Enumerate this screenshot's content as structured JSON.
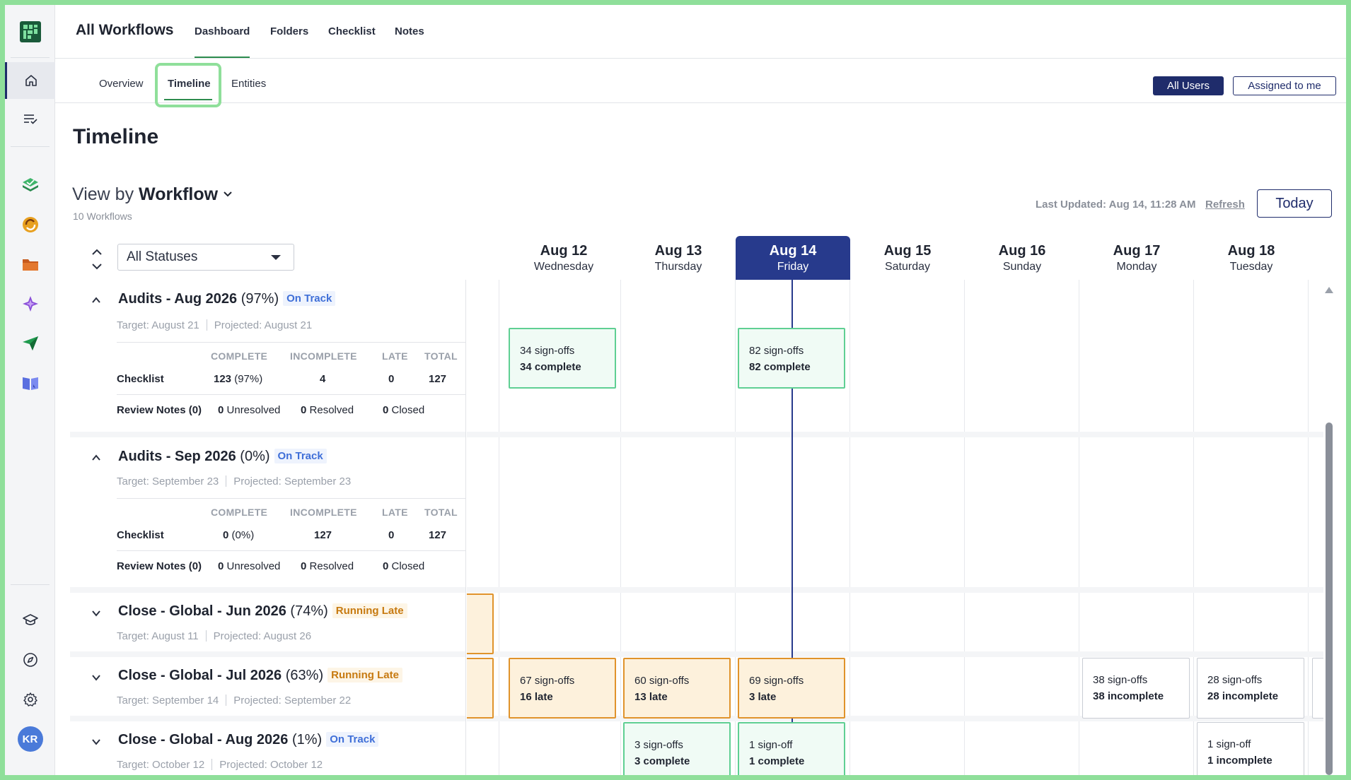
{
  "app": {
    "title": "All Workflows"
  },
  "topnav": [
    "Dashboard",
    "Folders",
    "Checklist",
    "Notes"
  ],
  "subnav": [
    "Overview",
    "Timeline",
    "Entities"
  ],
  "user_filter": {
    "all_users": "All Users",
    "assigned_to_me": "Assigned to me"
  },
  "page": {
    "title": "Timeline",
    "viewby_prefix": "View by",
    "viewby_value": "Workflow",
    "workflow_count": "10 Workflows",
    "last_updated": "Last Updated: Aug 14, 11:28 AM",
    "refresh": "Refresh",
    "today": "Today"
  },
  "status_filter": {
    "value": "All Statuses"
  },
  "days": [
    {
      "date": "Aug 12",
      "weekday": "Wednesday"
    },
    {
      "date": "Aug 13",
      "weekday": "Thursday"
    },
    {
      "date": "Aug 14",
      "weekday": "Friday",
      "today": true
    },
    {
      "date": "Aug 15",
      "weekday": "Saturday"
    },
    {
      "date": "Aug 16",
      "weekday": "Sunday"
    },
    {
      "date": "Aug 17",
      "weekday": "Monday"
    },
    {
      "date": "Aug 18",
      "weekday": "Tuesday"
    }
  ],
  "stat_headers": [
    "COMPLETE",
    "INCOMPLETE",
    "LATE",
    "TOTAL"
  ],
  "workflows": [
    {
      "name": "Audits - Aug 2026",
      "pct": "(97%)",
      "status": "On Track",
      "target": "Target: August 21",
      "projected": "Projected: August 21",
      "checklist": {
        "label": "Checklist",
        "complete": "123",
        "complete_pct": "(97%)",
        "incomplete": "4",
        "late": "0",
        "total": "127"
      },
      "notes": {
        "label": "Review Notes (0)",
        "unresolved": "0",
        "unresolved_label": "Unresolved",
        "resolved": "0",
        "resolved_label": "Resolved",
        "closed": "0",
        "closed_label": "Closed"
      }
    },
    {
      "name": "Audits - Sep 2026",
      "pct": "(0%)",
      "status": "On Track",
      "target": "Target: September 23",
      "projected": "Projected: September 23",
      "checklist": {
        "label": "Checklist",
        "complete": "0",
        "complete_pct": "(0%)",
        "incomplete": "127",
        "late": "0",
        "total": "127"
      },
      "notes": {
        "label": "Review Notes (0)",
        "unresolved": "0",
        "unresolved_label": "Unresolved",
        "resolved": "0",
        "resolved_label": "Resolved",
        "closed": "0",
        "closed_label": "Closed"
      }
    },
    {
      "name": "Close - Global - Jun 2026",
      "pct": "(74%)",
      "status": "Running Late",
      "target": "Target: August 11",
      "projected": "Projected: August 26"
    },
    {
      "name": "Close - Global - Jul 2026",
      "pct": "(63%)",
      "status": "Running Late",
      "target": "Target: September 14",
      "projected": "Projected: September 22"
    },
    {
      "name": "Close - Global - Aug 2026",
      "pct": "(1%)",
      "status": "On Track",
      "target": "Target: October 12",
      "projected": "Projected: October 12"
    }
  ],
  "events": [
    {
      "l1": "34 sign-offs",
      "l2": "34 complete"
    },
    {
      "l1": "82 sign-offs",
      "l2": "82 complete"
    },
    {
      "l1": "67 sign-offs",
      "l2": "16 late"
    },
    {
      "l1": "60 sign-offs",
      "l2": "13 late"
    },
    {
      "l1": "69 sign-offs",
      "l2": "3 late"
    },
    {
      "l1": "38 sign-offs",
      "l2": "38 incomplete"
    },
    {
      "l1": "28 sign-offs",
      "l2": "28 incomplete"
    },
    {
      "l1": "3 sign-offs",
      "l2": "3 complete"
    },
    {
      "l1": "1 sign-off",
      "l2": "1 complete"
    },
    {
      "l1": "1 sign-off",
      "l2": "1 incomplete"
    }
  ],
  "rail": {
    "avatar_initials": "KR"
  },
  "colors": {
    "primary_navy": "#1f2c6b",
    "today_header": "#273a8c",
    "accent_green": "#2d8c4e",
    "on_track_blue": "#3f6fd8",
    "running_late_orange": "#c77a10",
    "complete_border": "#5fcf93",
    "late_border": "#e0932b"
  }
}
